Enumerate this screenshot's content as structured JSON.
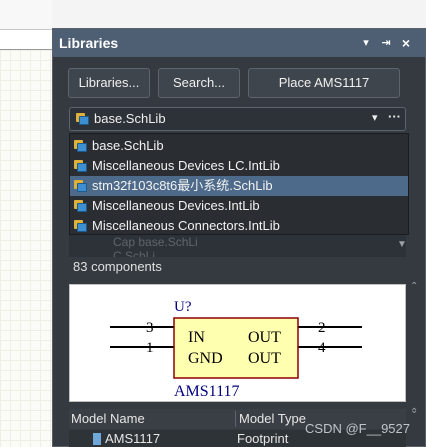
{
  "panel": {
    "title": "Libraries",
    "title_buttons": [
      "▾",
      "⇥",
      "×"
    ]
  },
  "toolbar": {
    "libraries_label": "Libraries...",
    "search_label": "Search...",
    "place_label": "Place AMS1117"
  },
  "library_select": {
    "value": "base.SchLib",
    "caret": "▾",
    "more": "···"
  },
  "dropdown": {
    "items": [
      {
        "label": "base.SchLib",
        "selected": false
      },
      {
        "label": "Miscellaneous Devices LC.IntLib",
        "selected": false
      },
      {
        "label": "stm32f103c8t6最小系统.SchLib",
        "selected": true
      },
      {
        "label": "Miscellaneous Devices.IntLib",
        "selected": false
      },
      {
        "label": "Miscellaneous Connectors.IntLib",
        "selected": false
      }
    ]
  },
  "component_list_ghost": {
    "row1": "Cap    base.SchLi",
    "row2": "C          SchLi"
  },
  "component_count": "83 components",
  "symbol": {
    "designator": "U?",
    "name": "AMS1117",
    "pins": {
      "left_top_num": "3",
      "left_bottom_num": "1",
      "right_top_num": "2",
      "right_bottom_num": "4",
      "in": "IN",
      "gnd": "GND",
      "out_top": "OUT",
      "out_bottom": "OUT"
    },
    "colors": {
      "body_fill": "#ffffb0",
      "body_stroke": "#8b0000",
      "text": "#000080",
      "pin": "#000000"
    }
  },
  "grid": {
    "headers": [
      "Model Name",
      "Model Type"
    ],
    "row": {
      "name": "AMS1117",
      "type": "Footprint"
    }
  },
  "watermark": "CSDN @F__9527",
  "colors": {
    "title_bar": "#4e5f74",
    "selection": "#4d6a8a",
    "panel_bg": "#353a40"
  }
}
